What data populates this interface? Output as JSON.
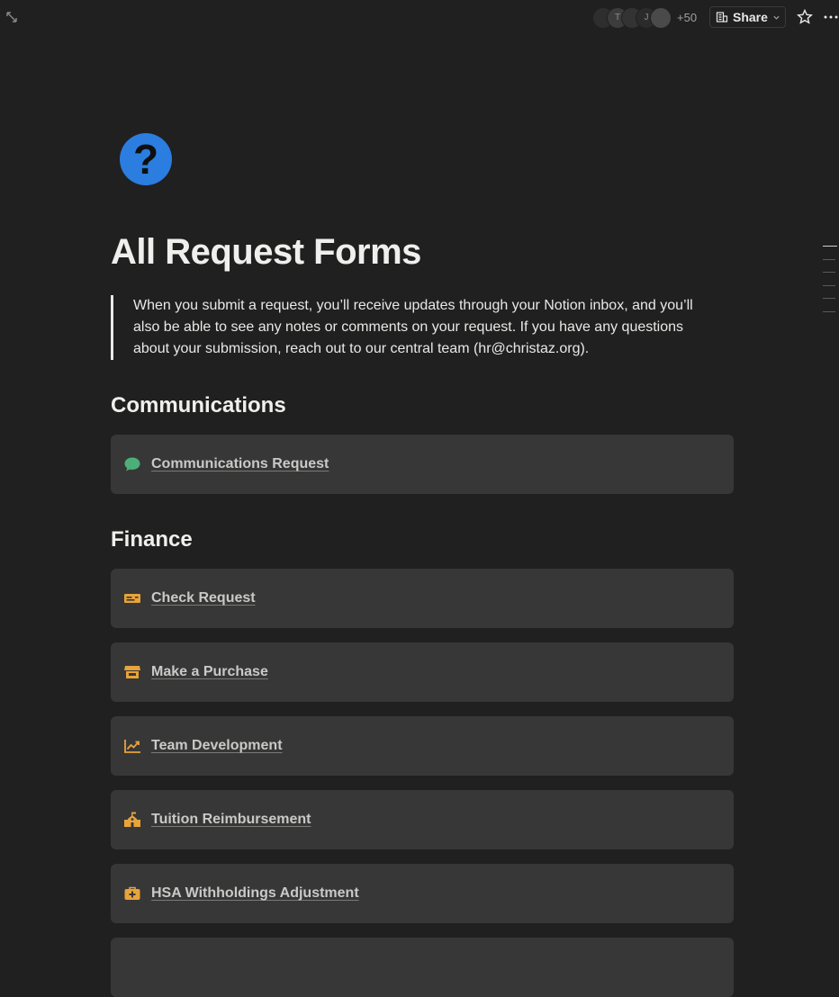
{
  "topbar": {
    "avatars": [
      "",
      "T",
      "",
      "J",
      ""
    ],
    "more_count": "+50",
    "share_label": "Share"
  },
  "page": {
    "icon_glyph": "?",
    "title": "All Request Forms",
    "callout": "When you submit a request, you’ll receive updates through your Notion inbox, and you’ll also be able to see any notes or comments on your request. If you have any questions about your submission, reach out to our central team (hr@christaz.org)."
  },
  "sections": [
    {
      "heading": "Communications",
      "items": [
        {
          "label": "Communications Request",
          "icon": "chat-bubble-icon",
          "color": "#4caf7a"
        }
      ]
    },
    {
      "heading": "Finance",
      "items": [
        {
          "label": "Check Request",
          "icon": "check-ticket-icon",
          "color": "#e8a33a"
        },
        {
          "label": "Make a Purchase",
          "icon": "storefront-icon",
          "color": "#e8a33a"
        },
        {
          "label": "Team Development",
          "icon": "trend-chart-icon",
          "color": "#e8a33a"
        },
        {
          "label": "Tuition Reimbursement",
          "icon": "school-building-icon",
          "color": "#e8a33a"
        },
        {
          "label": "HSA Withholdings Adjustment",
          "icon": "medical-kit-icon",
          "color": "#e8a33a"
        },
        {
          "label": "",
          "icon": "",
          "color": "#e8a33a"
        }
      ]
    }
  ]
}
